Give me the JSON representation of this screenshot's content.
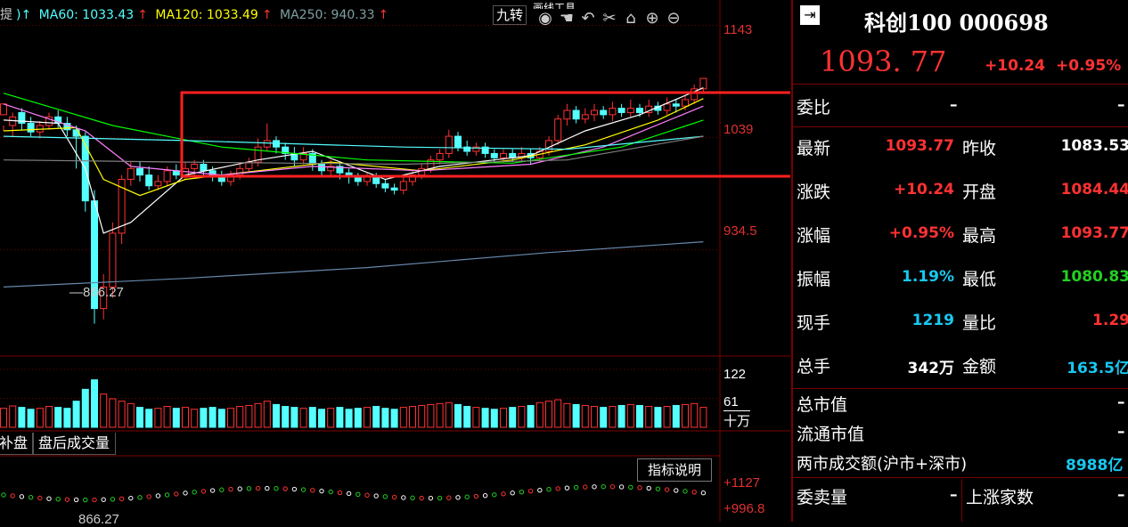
{
  "chart": {
    "legend": {
      "ma60": "MA60: 1033.43",
      "ma120": "MA120: 1033.49",
      "ma250": "MA250: 940.33",
      "arrow": "↑",
      "lead": "提",
      "lead2": ")↑"
    },
    "toolbar_label": "九转",
    "toolbar_partial": "画线工具",
    "price_axis": [
      "1143",
      "1039",
      "934.5"
    ],
    "low_annotation": "866.27",
    "volume_axis": [
      "122",
      "61",
      "十万"
    ],
    "tabs": [
      "补盘",
      "盘后成交量"
    ],
    "indicator_button": "指标说明",
    "indicator_axis": [
      "+1127",
      "+996.8"
    ],
    "indicator_low": "866.27",
    "colors": {
      "up": "#ff3232",
      "down": "#54ffff",
      "ma5": "#ffffff",
      "ma10": "#ffff00",
      "ma20": "#ff80ff",
      "ma60": "#00ff00",
      "ma120": "#54ffff",
      "ma250": "#808080",
      "highlight": "#ff2020"
    }
  },
  "chart_data": {
    "type": "candlestick",
    "ylim": [
      840,
      1150
    ],
    "candles": [
      [
        1060,
        1070,
        1050,
        1045
      ],
      [
        1050,
        1058,
        1062,
        1040
      ],
      [
        1062,
        1052,
        1066,
        1046
      ],
      [
        1052,
        1044,
        1058,
        1040
      ],
      [
        1044,
        1050,
        1054,
        1038
      ],
      [
        1050,
        1058,
        1062,
        1046
      ],
      [
        1058,
        1052,
        1064,
        1048
      ],
      [
        1052,
        1046,
        1058,
        1040
      ],
      [
        1046,
        1040,
        1050,
        1010
      ],
      [
        1040,
        980,
        1044,
        970
      ],
      [
        980,
        880,
        990,
        866
      ],
      [
        880,
        900,
        912,
        870
      ],
      [
        900,
        950,
        960,
        890
      ],
      [
        950,
        1000,
        1004,
        940
      ],
      [
        1000,
        1010,
        1016,
        994
      ],
      [
        1010,
        1004,
        1016,
        998
      ],
      [
        1004,
        994,
        1012,
        990
      ],
      [
        994,
        998,
        1004,
        990
      ],
      [
        998,
        1008,
        1012,
        994
      ],
      [
        1008,
        1004,
        1014,
        1000
      ],
      [
        1004,
        1010,
        1016,
        1000
      ],
      [
        1010,
        1014,
        1018,
        1004
      ],
      [
        1014,
        1008,
        1018,
        1004
      ],
      [
        1008,
        1002,
        1012,
        998
      ],
      [
        1002,
        998,
        1008,
        994
      ],
      [
        998,
        1004,
        1008,
        994
      ],
      [
        1004,
        1010,
        1014,
        1000
      ],
      [
        1010,
        1016,
        1020,
        1006
      ],
      [
        1016,
        1030,
        1038,
        1012
      ],
      [
        1030,
        1036,
        1052,
        1026
      ],
      [
        1036,
        1030,
        1040,
        1024
      ],
      [
        1030,
        1024,
        1034,
        1018
      ],
      [
        1024,
        1018,
        1030,
        1012
      ],
      [
        1018,
        1024,
        1030,
        1014
      ],
      [
        1024,
        1014,
        1028,
        1008
      ],
      [
        1014,
        1008,
        1018,
        1004
      ],
      [
        1008,
        1012,
        1018,
        1002
      ],
      [
        1012,
        1006,
        1016,
        1000
      ],
      [
        1006,
        1002,
        1010,
        996
      ],
      [
        1002,
        998,
        1006,
        994
      ],
      [
        998,
        1002,
        1006,
        994
      ],
      [
        1002,
        996,
        1006,
        992
      ],
      [
        996,
        992,
        1000,
        988
      ],
      [
        992,
        990,
        996,
        986
      ],
      [
        990,
        998,
        1002,
        986
      ],
      [
        998,
        1004,
        1008,
        994
      ],
      [
        1004,
        1010,
        1014,
        1000
      ],
      [
        1010,
        1018,
        1022,
        1006
      ],
      [
        1018,
        1024,
        1028,
        1014
      ],
      [
        1024,
        1040,
        1046,
        1020
      ],
      [
        1040,
        1030,
        1044,
        1026
      ],
      [
        1030,
        1026,
        1036,
        1022
      ],
      [
        1026,
        1030,
        1034,
        1022
      ],
      [
        1030,
        1024,
        1034,
        1020
      ],
      [
        1024,
        1020,
        1028,
        1016
      ],
      [
        1020,
        1024,
        1028,
        1016
      ],
      [
        1024,
        1020,
        1028,
        1016
      ],
      [
        1020,
        1024,
        1030,
        1016
      ],
      [
        1024,
        1020,
        1028,
        1014
      ],
      [
        1020,
        1026,
        1030,
        1016
      ],
      [
        1026,
        1036,
        1040,
        1022
      ],
      [
        1036,
        1056,
        1060,
        1032
      ],
      [
        1056,
        1064,
        1070,
        1050
      ],
      [
        1064,
        1056,
        1068,
        1052
      ],
      [
        1056,
        1060,
        1066,
        1052
      ],
      [
        1060,
        1064,
        1070,
        1054
      ],
      [
        1064,
        1060,
        1068,
        1056
      ],
      [
        1060,
        1066,
        1072,
        1054
      ],
      [
        1066,
        1062,
        1070,
        1058
      ],
      [
        1062,
        1066,
        1074,
        1058
      ],
      [
        1066,
        1062,
        1070,
        1058
      ],
      [
        1062,
        1068,
        1074,
        1058
      ],
      [
        1068,
        1064,
        1072,
        1060
      ],
      [
        1064,
        1070,
        1076,
        1060
      ],
      [
        1070,
        1068,
        1074,
        1062
      ],
      [
        1068,
        1074,
        1078,
        1064
      ],
      [
        1074,
        1084,
        1088,
        1070
      ],
      [
        1084,
        1093.77,
        1093.77,
        1080.83
      ]
    ],
    "ma_lines": {
      "ma5": [
        [
          0,
          1055
        ],
        [
          6,
          1052
        ],
        [
          9,
          1010
        ],
        [
          11,
          950
        ],
        [
          14,
          960
        ],
        [
          20,
          1004
        ],
        [
          28,
          1018
        ],
        [
          34,
          1026
        ],
        [
          42,
          1000
        ],
        [
          48,
          1012
        ],
        [
          58,
          1022
        ],
        [
          64,
          1045
        ],
        [
          70,
          1060
        ],
        [
          77,
          1085
        ]
      ],
      "ma10": [
        [
          0,
          1045
        ],
        [
          8,
          1048
        ],
        [
          11,
          1000
        ],
        [
          15,
          985
        ],
        [
          20,
          1000
        ],
        [
          28,
          1008
        ],
        [
          36,
          1016
        ],
        [
          46,
          1008
        ],
        [
          56,
          1018
        ],
        [
          64,
          1032
        ],
        [
          72,
          1055
        ],
        [
          77,
          1075
        ]
      ],
      "ma20": [
        [
          0,
          1070
        ],
        [
          9,
          1045
        ],
        [
          14,
          1012
        ],
        [
          24,
          1004
        ],
        [
          34,
          1012
        ],
        [
          46,
          1008
        ],
        [
          58,
          1014
        ],
        [
          66,
          1030
        ],
        [
          77,
          1068
        ]
      ],
      "ma60": [
        [
          0,
          1080
        ],
        [
          12,
          1050
        ],
        [
          24,
          1030
        ],
        [
          40,
          1018
        ],
        [
          56,
          1015
        ],
        [
          68,
          1030
        ],
        [
          77,
          1055
        ]
      ],
      "ma120": [
        [
          0,
          1040
        ],
        [
          20,
          1036
        ],
        [
          44,
          1030
        ],
        [
          62,
          1028
        ],
        [
          77,
          1040
        ]
      ],
      "ma250": [
        [
          0,
          1018
        ],
        [
          20,
          1016
        ],
        [
          44,
          1014
        ],
        [
          62,
          1018
        ],
        [
          77,
          1040
        ]
      ],
      "ma_long": [
        [
          0,
          900
        ],
        [
          20,
          908
        ],
        [
          40,
          918
        ],
        [
          60,
          932
        ],
        [
          77,
          942
        ]
      ]
    },
    "volume_ylim": [
      0,
      150
    ],
    "volume": [
      40,
      45,
      42,
      38,
      40,
      44,
      42,
      40,
      55,
      80,
      100,
      70,
      60,
      55,
      50,
      42,
      38,
      40,
      44,
      40,
      42,
      38,
      40,
      42,
      38,
      40,
      44,
      46,
      50,
      55,
      48,
      44,
      42,
      40,
      42,
      38,
      40,
      42,
      38,
      40,
      42,
      44,
      40,
      38,
      42,
      44,
      46,
      48,
      50,
      52,
      48,
      44,
      42,
      40,
      38,
      40,
      42,
      44,
      46,
      52,
      55,
      58,
      50,
      48,
      46,
      44,
      42,
      44,
      46,
      48,
      46,
      44,
      42,
      44,
      46,
      48,
      50,
      42
    ]
  },
  "info": {
    "title": "科创100 000698",
    "price": "1093. 77",
    "change": "+10.24",
    "change_pct": "+0.95%",
    "weibi_label": "委比",
    "weibi_value": "–",
    "weibi_value2": "–",
    "rows": [
      {
        "l1": "最新",
        "v1": "1093.77",
        "c1": "red",
        "l2": "昨收",
        "v2": "1083.53",
        "c2": "white"
      },
      {
        "l1": "涨跌",
        "v1": "+10.24",
        "c1": "red",
        "l2": "开盘",
        "v2": "1084.44",
        "c2": "red"
      },
      {
        "l1": "涨幅",
        "v1": "+0.95%",
        "c1": "red",
        "l2": "最高",
        "v2": "1093.77",
        "c2": "red"
      },
      {
        "l1": "振幅",
        "v1": "1.19%",
        "c1": "cyan",
        "l2": "最低",
        "v2": "1080.83",
        "c2": "green"
      },
      {
        "l1": "现手",
        "v1": "1219",
        "c1": "cyan",
        "l2": "量比",
        "v2": "1.29",
        "c2": "red"
      },
      {
        "l1": "总手",
        "v1": "342万",
        "c1": "white",
        "l2": "金额",
        "v2": "163.5亿",
        "c2": "cyan"
      }
    ],
    "total_market_value_label": "总市值",
    "total_market_value": "–",
    "float_market_value_label": "流通市值",
    "float_market_value": "–",
    "turnover_label": "两市成交额(沪市+深市)",
    "turnover_value": "8988亿",
    "bidask_label": "委卖量",
    "bidask_value": "–",
    "up_count_label": "上涨家数",
    "up_count_value": "–"
  }
}
